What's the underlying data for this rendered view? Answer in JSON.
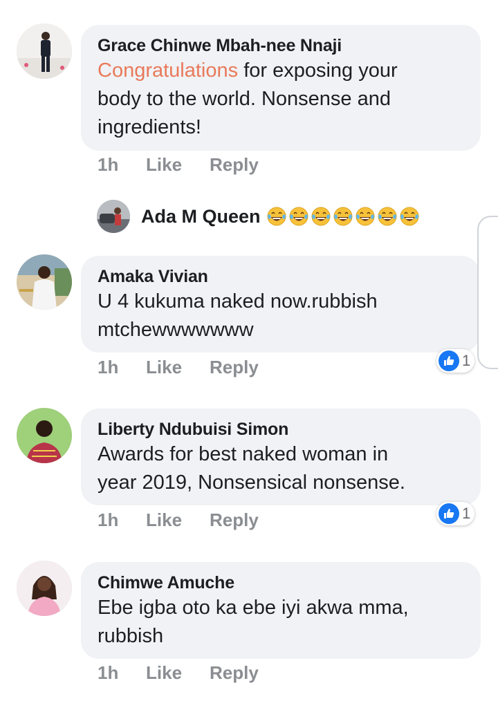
{
  "comments": [
    {
      "author": "Grace Chinwe Mbah-nee Nnaji",
      "text_highlight": "Congratulations",
      "text_rest": " for exposing your",
      "text_line2": "body to the world. Nonsense and",
      "text_line3": "ingredients!",
      "time": "1h",
      "like": "Like",
      "reply": "Reply"
    },
    {
      "author": "Amaka Vivian",
      "text_line1": "U 4 kukuma naked now.rubbish",
      "text_line2": "mtchewwwwwww",
      "time": "1h",
      "like": "Like",
      "reply": "Reply",
      "reactions": "1"
    },
    {
      "author": "Liberty Ndubuisi Simon",
      "text_line1": "Awards for best naked woman in",
      "text_line2": "year 2019, Nonsensical nonsense.",
      "time": "1h",
      "like": "Like",
      "reply": "Reply",
      "reactions": "1"
    },
    {
      "author": "Chimwe Amuche",
      "text_line1": "Ebe igba oto ka ebe iyi akwa mma,",
      "text_line2": "rubbish",
      "time": "1h",
      "like": "Like",
      "reply": "Reply"
    }
  ],
  "reply_preview": {
    "author": "Ada M Queen",
    "emoji_name": "tears-of-joy-emoji",
    "emoji_count": 7
  },
  "colors": {
    "bubble": "#f0f2f5",
    "highlight": "#e9795a",
    "meta": "#8a8d91",
    "like_blue": "#1877f2"
  }
}
